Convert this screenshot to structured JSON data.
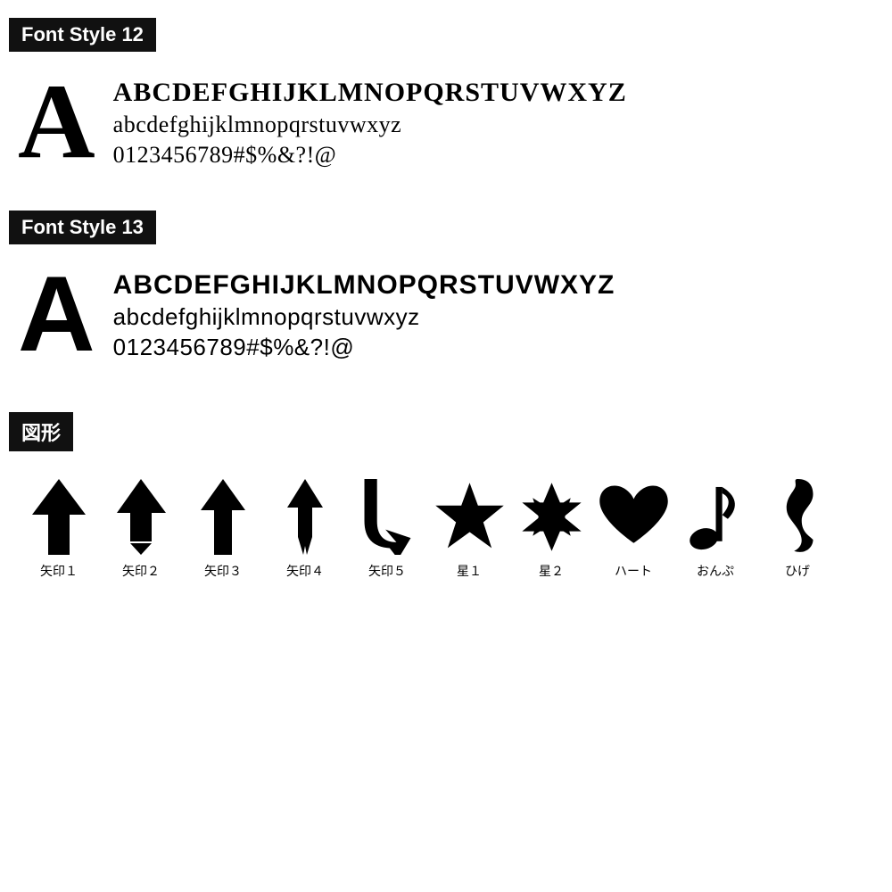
{
  "sections": {
    "font12": {
      "label": "Font Style 12",
      "bigLetter": "A",
      "uppercase": "BCDEFGHIJKLMNOPQRSTUVWXYZ",
      "lowercase": "abcdefghijklmnopqrstuvwxyz",
      "numbers": "0123456789#$%&?!@"
    },
    "font13": {
      "label": "Font Style 13",
      "bigLetter": "A",
      "uppercase": "BCDEFGHIJKLMNOPQRSTUVWXYZ",
      "lowercase": "abcdefghijklmnopqrstuvwxyz",
      "numbers": "0123456789#$%&?!@"
    },
    "shapes": {
      "label": "図形",
      "items": [
        {
          "id": "arrow1",
          "label": "矢印１"
        },
        {
          "id": "arrow2",
          "label": "矢印２"
        },
        {
          "id": "arrow3",
          "label": "矢印３"
        },
        {
          "id": "arrow4",
          "label": "矢印４"
        },
        {
          "id": "arrow5",
          "label": "矢印５"
        },
        {
          "id": "star1",
          "label": "星１"
        },
        {
          "id": "star2",
          "label": "星２"
        },
        {
          "id": "heart",
          "label": "ハート"
        },
        {
          "id": "music",
          "label": "おんぷ"
        },
        {
          "id": "mustache",
          "label": "ひげ"
        }
      ]
    }
  }
}
